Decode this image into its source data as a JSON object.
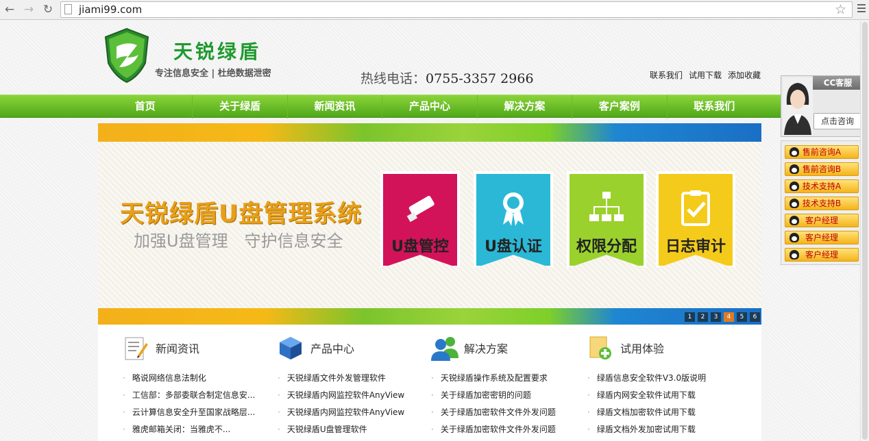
{
  "browser": {
    "back_icon": "back-arrow-icon",
    "forward_icon": "forward-arrow-icon",
    "reload_icon": "reload-icon",
    "url": "jiami99.com"
  },
  "header": {
    "brand_name": "天锐绿盾",
    "slogan": "专注信息安全 | 杜绝数据泄密",
    "hotline_label": "热线电话：",
    "hotline_number": "0755-3357 2966",
    "links": [
      "联系我们",
      "试用下载",
      "添加收藏"
    ]
  },
  "nav": {
    "items": [
      "首页",
      "关于绿盾",
      "新闻资讯",
      "产品中心",
      "解决方案",
      "客户案例",
      "联系我们"
    ]
  },
  "banner": {
    "title": "天锐绿盾U盘管理系统",
    "subtitle": "加强U盘管理　守护信息安全",
    "tiles": [
      {
        "label": "U盘管控",
        "icon": "usb-drive-icon",
        "color": "#d2135a"
      },
      {
        "label": "U盘认证",
        "icon": "award-ribbon-icon",
        "color": "#2bb8d6"
      },
      {
        "label": "权限分配",
        "icon": "org-chart-icon",
        "color": "#9bd12c"
      },
      {
        "label": "日志审计",
        "icon": "clipboard-check-icon",
        "color": "#f4cb1a"
      }
    ],
    "pager": [
      "1",
      "2",
      "3",
      "4",
      "5",
      "6"
    ],
    "pager_active": "4"
  },
  "columns": [
    {
      "title": "新闻资讯",
      "icon": "news-pencil-icon",
      "items": [
        "略说网络信息法制化",
        "工信部：多部委联合制定信息安...",
        "云计算信息安全升至国家战略层...",
        "雅虎邮箱关闭：当雅虎不..."
      ]
    },
    {
      "title": "产品中心",
      "icon": "product-cube-icon",
      "items": [
        "天锐绿盾文件外发管理软件",
        "天锐绿盾内网监控软件AnyView",
        "天锐绿盾内网监控软件AnyView",
        "天锐绿盾U盘管理软件"
      ]
    },
    {
      "title": "解决方案",
      "icon": "users-icon",
      "items": [
        "天锐绿盾操作系统及配置要求",
        "关于绿盾加密密钥的问题",
        "关于绿盾加密软件文件外发问题",
        "关于绿盾加密软件文件外发问题"
      ]
    },
    {
      "title": "试用体验",
      "icon": "add-document-icon",
      "items": [
        "绿盾信息安全软件V3.0版说明",
        "绿盾内网安全软件试用下载",
        "绿盾文档加密软件试用下载",
        "绿盾文档外发加密试用下载"
      ]
    }
  ],
  "support": {
    "title": "CC客服",
    "consult_label": "点击咨询",
    "buttons": [
      "售前咨询A",
      "售前咨询B",
      "技术支持A",
      "技术支持B",
      "客户经理",
      "客户经理",
      "客户经理"
    ]
  }
}
